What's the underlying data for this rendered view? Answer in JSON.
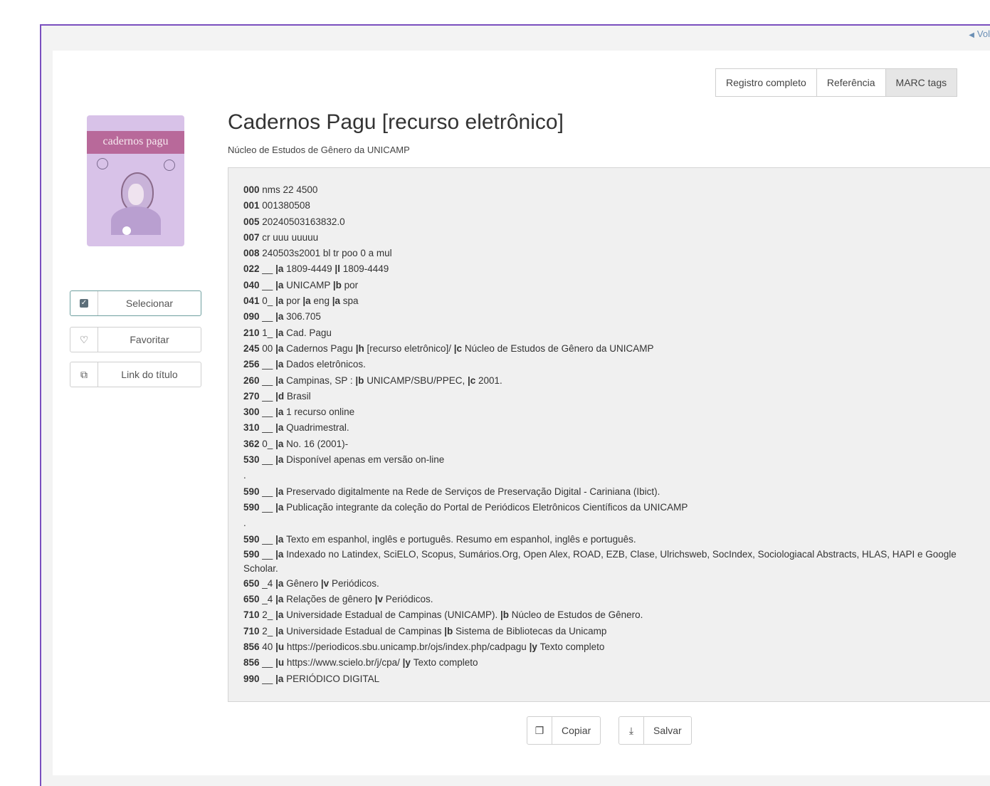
{
  "nav": {
    "back_label": "Vol"
  },
  "tabs": [
    {
      "label": "Registro completo"
    },
    {
      "label": "Referência"
    },
    {
      "label": "MARC tags"
    }
  ],
  "cover": {
    "title": "cadernos pagu"
  },
  "side_actions": {
    "select_label": "Selecionar",
    "favorite_label": "Favoritar",
    "link_label": "Link do título"
  },
  "record": {
    "title": "Cadernos Pagu [recurso eletrônico]",
    "subtitle": "Núcleo de Estudos de Gênero da UNICAMP"
  },
  "marc": [
    {
      "tag": "000",
      "parts": [
        [
          "",
          " nms 22 4500"
        ]
      ]
    },
    {
      "tag": "001",
      "parts": [
        [
          "",
          "001380508"
        ]
      ]
    },
    {
      "tag": "005",
      "parts": [
        [
          "",
          "20240503163832.0"
        ]
      ]
    },
    {
      "tag": "007",
      "parts": [
        [
          "",
          "cr uuu uuuuu"
        ]
      ]
    },
    {
      "tag": "008",
      "parts": [
        [
          "",
          "240503s2001 bl tr poo 0 a mul"
        ]
      ]
    },
    {
      "tag": "022",
      "ind": "__",
      "parts": [
        [
          "|a",
          "1809-4449"
        ],
        [
          "|l",
          "1809-4449"
        ]
      ]
    },
    {
      "tag": "040",
      "ind": "__",
      "parts": [
        [
          "|a",
          "UNICAMP"
        ],
        [
          "|b",
          "por"
        ]
      ]
    },
    {
      "tag": "041",
      "ind": "0_",
      "parts": [
        [
          "|a",
          "por"
        ],
        [
          "|a",
          "eng"
        ],
        [
          "|a",
          "spa"
        ]
      ]
    },
    {
      "tag": "090",
      "ind": "__",
      "parts": [
        [
          "|a",
          "306.705"
        ]
      ]
    },
    {
      "tag": "210",
      "ind": "1_",
      "parts": [
        [
          "|a",
          "Cad. Pagu"
        ]
      ]
    },
    {
      "tag": "245",
      "ind": "00",
      "parts": [
        [
          "|a",
          "Cadernos Pagu"
        ],
        [
          "|h",
          "[recurso eletrônico]/"
        ],
        [
          "|c",
          "Núcleo de Estudos de Gênero da UNICAMP"
        ]
      ]
    },
    {
      "tag": "256",
      "ind": "__",
      "parts": [
        [
          "|a",
          "Dados eletrônicos."
        ]
      ]
    },
    {
      "tag": "260",
      "ind": "__",
      "parts": [
        [
          "|a",
          "Campinas, SP :"
        ],
        [
          "|b",
          "UNICAMP/SBU/PPEC,"
        ],
        [
          "|c",
          "2001."
        ]
      ]
    },
    {
      "tag": "270",
      "ind": "__",
      "parts": [
        [
          "|d",
          "Brasil"
        ]
      ]
    },
    {
      "tag": "300",
      "ind": "__",
      "parts": [
        [
          "|a",
          "1 recurso online"
        ]
      ]
    },
    {
      "tag": "310",
      "ind": "__",
      "parts": [
        [
          "|a",
          "Quadrimestral."
        ]
      ]
    },
    {
      "tag": "362",
      "ind": "0_",
      "parts": [
        [
          "|a",
          "No. 16 (2001)-"
        ]
      ]
    },
    {
      "tag": "530",
      "ind": "__",
      "parts": [
        [
          "|a",
          "Disponível apenas em versão on-line"
        ]
      ]
    },
    {
      "dot": "."
    },
    {
      "tag": "590",
      "ind": "__",
      "parts": [
        [
          "|a",
          "Preservado digitalmente na Rede de Serviços de Preservação Digital - Cariniana (Ibict)."
        ]
      ]
    },
    {
      "tag": "590",
      "ind": "__",
      "parts": [
        [
          "|a",
          "Publicação integrante da coleção do Portal de Periódicos Eletrônicos Científicos da UNICAMP"
        ]
      ]
    },
    {
      "dot": "."
    },
    {
      "tag": "590",
      "ind": "__",
      "parts": [
        [
          "|a",
          "Texto em espanhol, inglês e português. Resumo em espanhol, inglês e português."
        ]
      ]
    },
    {
      "tag": "590",
      "ind": "__",
      "wrap": true,
      "parts": [
        [
          "|a",
          "Indexado no Latindex, SciELO, Scopus, Sumários.Org, Open Alex, ROAD, EZB, Clase, Ulrichsweb, SocIndex, Sociologiacal Abstracts, HLAS, HAPI e Google Scholar."
        ]
      ]
    },
    {
      "tag": "650",
      "ind": "_4",
      "parts": [
        [
          "|a",
          "Gênero"
        ],
        [
          "|v",
          "Periódicos."
        ]
      ]
    },
    {
      "tag": "650",
      "ind": "_4",
      "parts": [
        [
          "|a",
          "Relações de gênero"
        ],
        [
          "|v",
          "Periódicos."
        ]
      ]
    },
    {
      "tag": "710",
      "ind": "2_",
      "parts": [
        [
          "|a",
          "Universidade Estadual de Campinas (UNICAMP)."
        ],
        [
          "|b",
          "Núcleo de Estudos de Gênero."
        ]
      ]
    },
    {
      "tag": "710",
      "ind": "2_",
      "parts": [
        [
          "|a",
          "Universidade Estadual de Campinas"
        ],
        [
          "|b",
          "Sistema de Bibliotecas da Unicamp"
        ]
      ]
    },
    {
      "tag": "856",
      "ind": "40",
      "parts": [
        [
          "|u",
          "https://periodicos.sbu.unicamp.br/ojs/index.php/cadpagu"
        ],
        [
          "|y",
          "Texto completo"
        ]
      ]
    },
    {
      "tag": "856",
      "ind": "__",
      "parts": [
        [
          "|u",
          "https://www.scielo.br/j/cpa/"
        ],
        [
          "|y",
          "Texto completo"
        ]
      ]
    },
    {
      "tag": "990",
      "ind": "__",
      "parts": [
        [
          "|a",
          "PERIÓDICO DIGITAL"
        ]
      ]
    }
  ],
  "bottom_actions": {
    "copy_label": "Copiar",
    "save_label": "Salvar"
  }
}
